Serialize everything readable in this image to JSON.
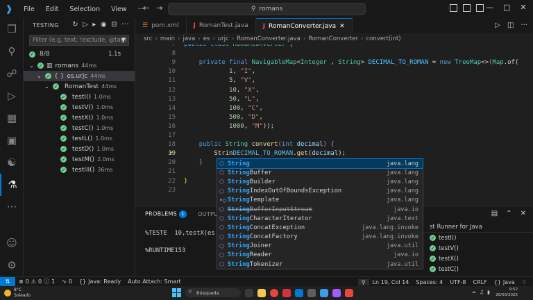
{
  "titlebar": {
    "menu": [
      "File",
      "Edit",
      "Selection",
      "View",
      "···"
    ],
    "search_text": "romans"
  },
  "sidebar": {
    "title": "TESTING",
    "filter_placeholder": "Filter (e.g. text, !exclude, @tag)",
    "summary_count": "8/8",
    "summary_duration": "1.1s",
    "tree": [
      {
        "label": "romans",
        "duration": "44ms",
        "depth": 0,
        "icon": "module"
      },
      {
        "label": "es.urjc",
        "duration": "44ms",
        "depth": 1,
        "icon": "package",
        "selected": true
      },
      {
        "label": "RomanTest",
        "duration": "44ms",
        "depth": 2,
        "icon": "class"
      },
      {
        "label": "testI()",
        "duration": "1.0ms",
        "depth": 3,
        "icon": "method"
      },
      {
        "label": "testV()",
        "duration": "1.0ms",
        "depth": 3,
        "icon": "method"
      },
      {
        "label": "testX()",
        "duration": "1.0ms",
        "depth": 3,
        "icon": "method"
      },
      {
        "label": "testC()",
        "duration": "1.0ms",
        "depth": 3,
        "icon": "method"
      },
      {
        "label": "testL()",
        "duration": "1.0ms",
        "depth": 3,
        "icon": "method"
      },
      {
        "label": "testD()",
        "duration": "1.0ms",
        "depth": 3,
        "icon": "method"
      },
      {
        "label": "testM()",
        "duration": "2.0ms",
        "depth": 3,
        "icon": "method"
      },
      {
        "label": "testIII()",
        "duration": "36ms",
        "depth": 3,
        "icon": "method"
      }
    ]
  },
  "tabs": [
    {
      "label": "pom.xml",
      "icon": "xml",
      "active": false
    },
    {
      "label": "RomanTest.java",
      "icon": "java",
      "active": false
    },
    {
      "label": "RomanConverter.java",
      "icon": "java",
      "active": true
    }
  ],
  "breadcrumb": [
    "src",
    "main",
    "java",
    "es",
    "urjc",
    "RomanConverter.java",
    "RomanConverter",
    "convert(int)"
  ],
  "editor": {
    "lines": [
      {
        "n": "7",
        "tokens": [
          [
            "kw",
            "public "
          ],
          [
            "kw",
            "class "
          ],
          [
            "ty",
            "RomanConverter "
          ],
          [
            "br",
            "{"
          ]
        ]
      },
      {
        "n": "8",
        "tokens": []
      },
      {
        "n": "9",
        "tokens": [
          [
            "",
            "    "
          ],
          [
            "kw",
            "private "
          ],
          [
            "kw",
            "final "
          ],
          [
            "ty",
            "NavigableMap"
          ],
          [
            "",
            "<"
          ],
          [
            "ty",
            "Integer"
          ],
          [
            "",
            " , "
          ],
          [
            "ty",
            "String"
          ],
          [
            "",
            "> "
          ],
          [
            "va",
            "DECIMAL_TO_ROMAN"
          ],
          [
            "",
            " = "
          ],
          [
            "kw",
            "new "
          ],
          [
            "ty",
            "TreeMap"
          ],
          [
            "",
            "<>"
          ],
          [
            "br2",
            "("
          ],
          [
            "ty",
            "Map"
          ],
          [
            "",
            ".of("
          ]
        ]
      },
      {
        "n": "10",
        "tokens": [
          [
            "",
            "            "
          ],
          [
            "nu",
            "1"
          ],
          [
            "",
            ", "
          ],
          [
            "st",
            "\"I\""
          ],
          [
            "",
            ","
          ]
        ]
      },
      {
        "n": "11",
        "tokens": [
          [
            "",
            "            "
          ],
          [
            "nu",
            "5"
          ],
          [
            "",
            ", "
          ],
          [
            "st",
            "\"V\""
          ],
          [
            "",
            ","
          ]
        ]
      },
      {
        "n": "12",
        "tokens": [
          [
            "",
            "            "
          ],
          [
            "nu",
            "10"
          ],
          [
            "",
            ", "
          ],
          [
            "st",
            "\"X\""
          ],
          [
            "",
            ","
          ]
        ]
      },
      {
        "n": "13",
        "tokens": [
          [
            "",
            "            "
          ],
          [
            "nu",
            "50"
          ],
          [
            "",
            ", "
          ],
          [
            "st",
            "\"L\""
          ],
          [
            "",
            ","
          ]
        ]
      },
      {
        "n": "14",
        "tokens": [
          [
            "",
            "            "
          ],
          [
            "nu",
            "100"
          ],
          [
            "",
            ", "
          ],
          [
            "st",
            "\"C\""
          ],
          [
            "",
            ","
          ]
        ]
      },
      {
        "n": "15",
        "tokens": [
          [
            "",
            "            "
          ],
          [
            "nu",
            "500"
          ],
          [
            "",
            ", "
          ],
          [
            "st",
            "\"D\""
          ],
          [
            "",
            ","
          ]
        ]
      },
      {
        "n": "16",
        "tokens": [
          [
            "",
            "            "
          ],
          [
            "nu",
            "1000"
          ],
          [
            "",
            ", "
          ],
          [
            "st",
            "\"M\""
          ],
          [
            "",
            "));"
          ]
        ]
      },
      {
        "n": "17",
        "tokens": []
      },
      {
        "n": "18",
        "tokens": [
          [
            "",
            "    "
          ],
          [
            "kw",
            "public "
          ],
          [
            "ty",
            "String "
          ],
          [
            "fn",
            "convert"
          ],
          [
            "br2",
            "("
          ],
          [
            "kw",
            "int "
          ],
          [
            "pa",
            "decimal"
          ],
          [
            "br2",
            ") "
          ],
          [
            "br2",
            "{"
          ]
        ]
      },
      {
        "n": "19",
        "tokens": [
          [
            "",
            "        "
          ],
          [
            "",
            "Strin"
          ],
          [
            "va",
            "DECIMAL_TO_ROMAN"
          ],
          [
            "",
            "."
          ],
          [
            "fn",
            "get"
          ],
          [
            "",
            "("
          ],
          [
            "pa",
            "decimal"
          ],
          [
            "",
            ");"
          ]
        ],
        "current": true,
        "bulb": true
      },
      {
        "n": "20",
        "tokens": [
          [
            "",
            "    "
          ],
          [
            "br2",
            "}"
          ]
        ]
      },
      {
        "n": "21",
        "tokens": []
      },
      {
        "n": "22",
        "tokens": [
          [
            "br",
            "}"
          ]
        ]
      },
      {
        "n": "23",
        "tokens": []
      }
    ]
  },
  "suggest": [
    {
      "match": "String",
      "rest": "",
      "pkg": "java.lang",
      "kind": "class",
      "focused": true
    },
    {
      "match": "String",
      "rest": "Buffer",
      "pkg": "java.lang",
      "kind": "class"
    },
    {
      "match": "String",
      "rest": "Builder",
      "pkg": "java.lang",
      "kind": "class"
    },
    {
      "match": "String",
      "rest": "IndexOutOfBoundsException",
      "pkg": "java.lang",
      "kind": "class"
    },
    {
      "match": "String",
      "rest": "Template",
      "pkg": "java.lang",
      "kind": "interface"
    },
    {
      "match": "String",
      "rest": "BufferInputStream",
      "pkg": "java.io",
      "kind": "class",
      "deprecated": true
    },
    {
      "match": "String",
      "rest": "CharacterIterator",
      "pkg": "java.text",
      "kind": "class"
    },
    {
      "match": "String",
      "rest": "ConcatException",
      "pkg": "java.lang.invoke",
      "kind": "class"
    },
    {
      "match": "String",
      "rest": "ConcatFactory",
      "pkg": "java.lang.invoke",
      "kind": "class"
    },
    {
      "match": "String",
      "rest": "Joiner",
      "pkg": "java.util",
      "kind": "class"
    },
    {
      "match": "String",
      "rest": "Reader",
      "pkg": "java.io",
      "kind": "class"
    },
    {
      "match": "String",
      "rest": "Tokenizer",
      "pkg": "java.util",
      "kind": "class"
    }
  ],
  "panel": {
    "tabs": [
      "PROBLEMS",
      "OUTPUT"
    ],
    "problems_badge": "1",
    "terminal_lines": [
      "%TESTE  10,testX(es",
      "",
      "%RUNTIME153"
    ],
    "test_runner_title": "st Runner for Java",
    "test_runner_items": [
      "testI()",
      "testV()",
      "testX()",
      "testC()"
    ]
  },
  "statusbar": {
    "errors": "0",
    "warnings": "0",
    "infos": "1",
    "ports": "0",
    "java_status": "Java: Ready",
    "auto_attach": "Auto Attach: Smart",
    "cursor": "Ln 19, Col 14",
    "spaces": "Spaces: 4",
    "encoding": "UTF-8",
    "eol": "CRLF",
    "lang": "Java"
  },
  "taskbar": {
    "weather_temp": "8°C",
    "weather_text": "Soleado",
    "search": "Búsqueda",
    "time": "9:52",
    "date": "26/03/2025"
  },
  "colors": {
    "accent": "#0078d4",
    "pass": "#73c991",
    "match_highlight": "#2aaaff"
  }
}
